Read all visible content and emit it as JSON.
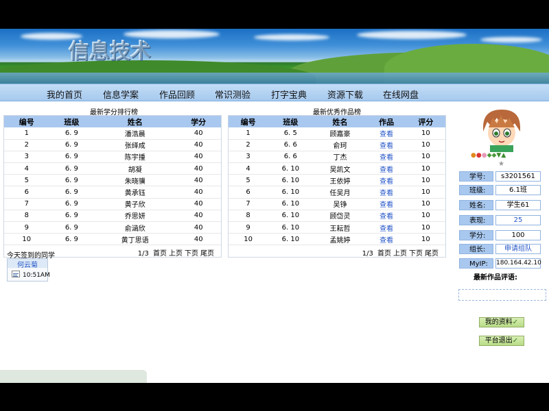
{
  "banner": {
    "title": "信息技术"
  },
  "nav": {
    "items": [
      "我的首页",
      "信息学案",
      "作品回顾",
      "常识测验",
      "打字宝典",
      "资源下载",
      "在线网盘"
    ]
  },
  "credit_rank": {
    "title": "最新学分排行榜",
    "headers": [
      "编号",
      "班级",
      "姓名",
      "学分"
    ],
    "rows": [
      [
        "1",
        "6. 9",
        "潘浩晨",
        "40"
      ],
      [
        "2",
        "6. 9",
        "张绎成",
        "40"
      ],
      [
        "3",
        "6. 9",
        "陈宇揰",
        "40"
      ],
      [
        "4",
        "6. 9",
        "胡凝",
        "40"
      ],
      [
        "5",
        "6. 9",
        "朱晓骥",
        "40"
      ],
      [
        "6",
        "6. 9",
        "黄承钰",
        "40"
      ],
      [
        "7",
        "6. 9",
        "黄子欣",
        "40"
      ],
      [
        "8",
        "6. 9",
        "乔思妍",
        "40"
      ],
      [
        "9",
        "6. 9",
        "俞涵欣",
        "40"
      ],
      [
        "10",
        "6. 9",
        "黄丁思语",
        "40"
      ]
    ],
    "pager": {
      "page": "1/3",
      "first": "首页",
      "prev": "上页",
      "next": "下页",
      "last": "尾页"
    }
  },
  "works_rank": {
    "title": "最新优秀作品榜",
    "headers": [
      "编号",
      "班级",
      "姓名",
      "作品",
      "评分"
    ],
    "rows": [
      [
        "1",
        "6. 5",
        "顾嘉豪",
        "查看",
        "10"
      ],
      [
        "2",
        "6. 6",
        "俞珂",
        "查看",
        "10"
      ],
      [
        "3",
        "6. 6",
        "丁杰",
        "查看",
        "10"
      ],
      [
        "4",
        "6. 10",
        "吴凯文",
        "查看",
        "10"
      ],
      [
        "5",
        "6. 10",
        "王依婷",
        "查看",
        "10"
      ],
      [
        "6",
        "6. 10",
        "任吴月",
        "查看",
        "10"
      ],
      [
        "7",
        "6. 10",
        "吴铮",
        "查看",
        "10"
      ],
      [
        "8",
        "6. 10",
        "顾岱灵",
        "查看",
        "10"
      ],
      [
        "9",
        "6. 10",
        "王耘哲",
        "查看",
        "10"
      ],
      [
        "10",
        "6. 10",
        "孟姚婷",
        "查看",
        "10"
      ]
    ],
    "pager": {
      "page": "1/3",
      "first": "首页",
      "prev": "上页",
      "next": "下页",
      "last": "尾页"
    }
  },
  "signin": {
    "title": "今天签到的同学",
    "name": "何云菊",
    "time": "10:51AM"
  },
  "profile": {
    "fields": [
      {
        "label": "学号:",
        "value": "s3201561",
        "link": false
      },
      {
        "label": "班级:",
        "value": "6.1班",
        "link": false
      },
      {
        "label": "姓名:",
        "value": "学生61",
        "link": false
      },
      {
        "label": "表现:",
        "value": "25",
        "link": true
      },
      {
        "label": "学分:",
        "value": "100",
        "link": false
      },
      {
        "label": "组长:",
        "value": "申请组队",
        "link": true
      },
      {
        "label": "MyIP:",
        "value": "180.164.42.10",
        "link": false
      }
    ],
    "comments_title": "最新作品评语:",
    "buttons": {
      "profile": "我的资料",
      "logout": "平台退出"
    }
  },
  "colors": {
    "header_blue": "#a9c8ef",
    "link_blue": "#2456c8",
    "button_green": "#b8dc86"
  }
}
